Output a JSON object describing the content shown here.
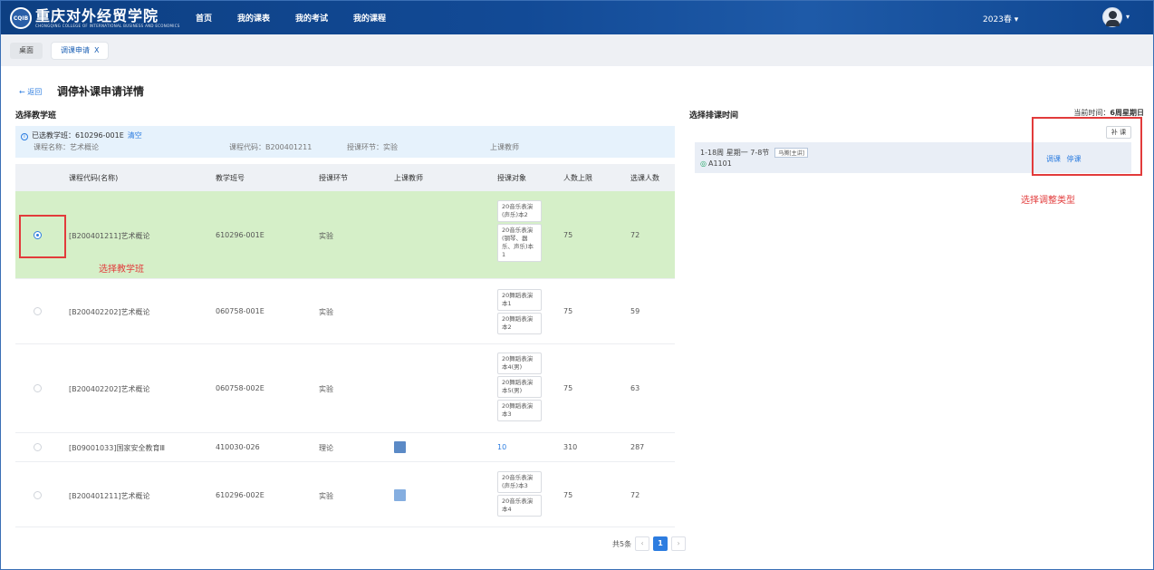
{
  "header": {
    "logo_text": "重庆对外经贸学院",
    "logo_subtext": "CHONGQING COLLEGE OF INTERNATIONAL BUSINESS AND ECONOMICS",
    "nav": [
      "首页",
      "我的课表",
      "我的考试",
      "我的课程"
    ],
    "term": "2023春",
    "term_caret": "▾",
    "avatar_caret": "▾"
  },
  "tabs": {
    "desk": "桌面",
    "active": "调课申请",
    "close": "X"
  },
  "page": {
    "back": "← 返回",
    "title": "调停补课申请详情",
    "left_section": "选择教学班",
    "right_section": "选择排课时间"
  },
  "selected": {
    "line1": "已选教学班：610296-001E",
    "clear": "清空",
    "course_name": "课程名称：艺术概论",
    "course_code": "课程代码：B200401211",
    "link": "授课环节：实验",
    "teacher": "上课教师"
  },
  "table": {
    "headers": [
      "课程代码(名称)",
      "教学班号",
      "授课环节",
      "上课教师",
      "授课对象",
      "人数上限",
      "选课人数"
    ],
    "rows": [
      {
        "selected": true,
        "name": "[B200401211]艺术概论",
        "class_no": "610296-001E",
        "link": "实验",
        "targets": [
          "20音乐表演(声乐)本2",
          "20音乐表演(钢琴、器乐、声乐)本1"
        ],
        "cap": "75",
        "count": "72"
      },
      {
        "selected": false,
        "name": "[B200402202]艺术概论",
        "class_no": "060758-001E",
        "link": "实验",
        "targets": [
          "20舞蹈表演本1",
          "20舞蹈表演本2"
        ],
        "cap": "75",
        "count": "59"
      },
      {
        "selected": false,
        "name": "[B200402202]艺术概论",
        "class_no": "060758-002E",
        "link": "实验",
        "targets": [
          "20舞蹈表演本4(男)",
          "20舞蹈表演本5(男)",
          "20舞蹈表演本3"
        ],
        "cap": "75",
        "count": "63"
      },
      {
        "selected": false,
        "name": "[B09001033]国家安全教育Ⅲ",
        "class_no": "410030-026",
        "link": "理论",
        "targets_count": "10",
        "cap": "310",
        "count": "287",
        "swatch_color": "#5b8ac6"
      },
      {
        "selected": false,
        "name": "[B200401211]艺术概论",
        "class_no": "610296-002E",
        "link": "实验",
        "targets": [
          "20音乐表演(声乐)本3",
          "20音乐表演本4"
        ],
        "cap": "75",
        "count": "72",
        "swatch_color": "#85aee0"
      }
    ]
  },
  "pager": {
    "total": "共5条",
    "prev": "‹",
    "current": "1",
    "next": "›"
  },
  "right": {
    "current_time_label": "当前时间：",
    "current_time_value": "6周星期日",
    "makeup_button": "补 课",
    "schedule_line1": "1-18周 星期一 7-8节",
    "schedule_role": "马腾[主讲]",
    "room": "A1101",
    "action_adjust": "调课",
    "action_stop": "停课"
  },
  "annotations": {
    "select_class": "选择教学班",
    "select_type": "选择调整类型",
    "color": "#e23b3b"
  }
}
